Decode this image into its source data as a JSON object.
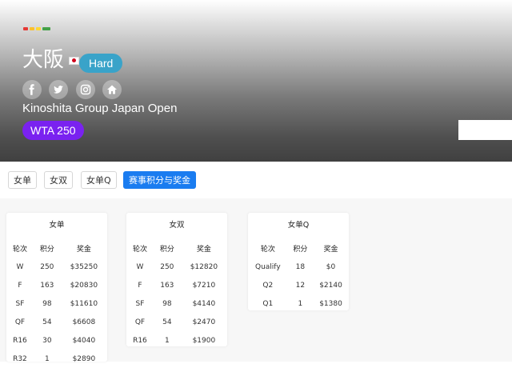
{
  "header": {
    "city": "大阪",
    "surface": "Hard",
    "tournament_name": "Kinoshita Group Japan Open",
    "level": "WTA 250",
    "social_icons": [
      "facebook-icon",
      "twitter-icon",
      "instagram-icon",
      "home-icon"
    ],
    "colors": {
      "surface_badge": "#39a3c9",
      "level_badge": "#7a22f0"
    }
  },
  "tabs": [
    {
      "label": "女单",
      "active": false
    },
    {
      "label": "女双",
      "active": false
    },
    {
      "label": "女单Q",
      "active": false
    },
    {
      "label": "赛事积分与奖金",
      "active": true
    }
  ],
  "tables": [
    {
      "title": "女单",
      "headers": [
        "轮次",
        "积分",
        "奖金"
      ],
      "rows": [
        [
          "W",
          "250",
          "$35250"
        ],
        [
          "F",
          "163",
          "$20830"
        ],
        [
          "SF",
          "98",
          "$11610"
        ],
        [
          "QF",
          "54",
          "$6608"
        ],
        [
          "R16",
          "30",
          "$4040"
        ],
        [
          "R32",
          "1",
          "$2890"
        ]
      ]
    },
    {
      "title": "女双",
      "headers": [
        "轮次",
        "积分",
        "奖金"
      ],
      "rows": [
        [
          "W",
          "250",
          "$12820"
        ],
        [
          "F",
          "163",
          "$7210"
        ],
        [
          "SF",
          "98",
          "$4140"
        ],
        [
          "QF",
          "54",
          "$2470"
        ],
        [
          "R16",
          "1",
          "$1900"
        ]
      ]
    },
    {
      "title": "女单Q",
      "headers": [
        "轮次",
        "积分",
        "奖金"
      ],
      "rows": [
        [
          "Qualify",
          "18",
          "$0"
        ],
        [
          "Q2",
          "12",
          "$2140"
        ],
        [
          "Q1",
          "1",
          "$1380"
        ]
      ]
    }
  ],
  "colors": {
    "active_tab": "#1a7cf0"
  }
}
